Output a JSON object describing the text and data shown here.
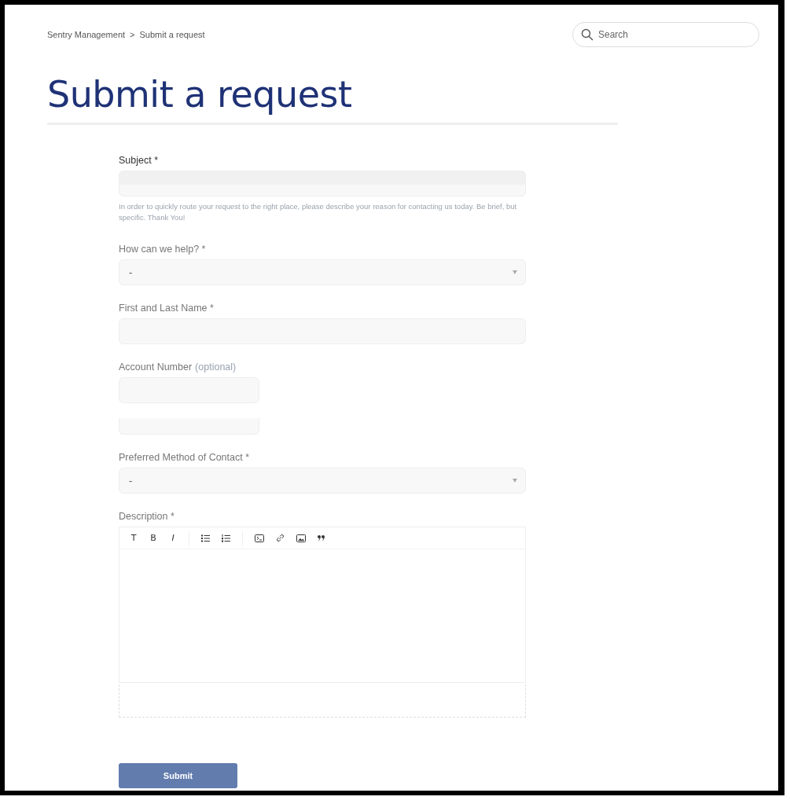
{
  "breadcrumb": [
    {
      "label": "Sentry Management"
    },
    {
      "label": "Submit a request"
    }
  ],
  "breadcrumb_separator": ">",
  "search": {
    "placeholder": "Search"
  },
  "title": "Submit a request",
  "fields": [
    {
      "kind": "text",
      "label": "Subject *",
      "hint": "In order to quickly route your request to the right place, please describe your reason for contacting us today. Be brief, but specific. Thank You!"
    },
    {
      "kind": "select",
      "label": "How can we help? *",
      "value": "-"
    },
    {
      "kind": "text",
      "label": "First and Last Name *"
    },
    {
      "kind": "short",
      "label": "Account Number",
      "optional": "(optional)"
    },
    {
      "kind": "select",
      "label": "Preferred Method of Contact *",
      "value": "-"
    },
    {
      "kind": "editor",
      "label": "Description *"
    }
  ],
  "toolbar": [
    {
      "kind": "text",
      "label": "T"
    },
    {
      "kind": "bold",
      "label": "B"
    },
    {
      "kind": "italic",
      "label": "I"
    },
    {
      "kind": "divider"
    },
    {
      "kind": "bullets"
    },
    {
      "kind": "numbers"
    },
    {
      "kind": "divider"
    },
    {
      "kind": "code"
    },
    {
      "kind": "link"
    },
    {
      "kind": "image"
    },
    {
      "kind": "quote"
    }
  ],
  "submit": "Submit"
}
